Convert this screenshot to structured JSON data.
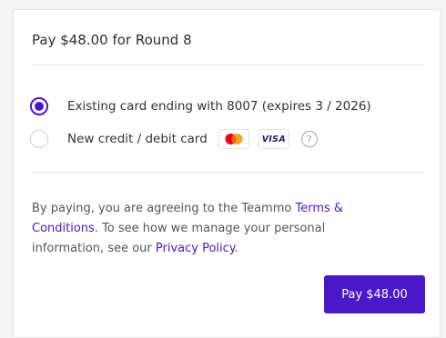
{
  "header": {
    "title": "Pay $48.00 for Round 8"
  },
  "payment_options": [
    {
      "label": "Existing card ending with 8007 (expires 3 / 2026)",
      "selected": true
    },
    {
      "label": "New credit / debit card",
      "selected": false
    }
  ],
  "card_brands": {
    "visa_label": "VISA",
    "help_symbol": "?"
  },
  "terms": {
    "text_before": "By paying, you are agreeing to the Teammo ",
    "terms_link": "Terms & Conditions",
    "text_middle": ". To see how we manage your personal information, see our ",
    "privacy_link": "Privacy Policy",
    "text_after": "."
  },
  "actions": {
    "pay_label": "Pay $48.00"
  },
  "colors": {
    "accent": "#4a17c9",
    "mastercard_red": "#eb001b",
    "mastercard_yellow": "#f79e1b",
    "visa_blue": "#1a1f71"
  }
}
